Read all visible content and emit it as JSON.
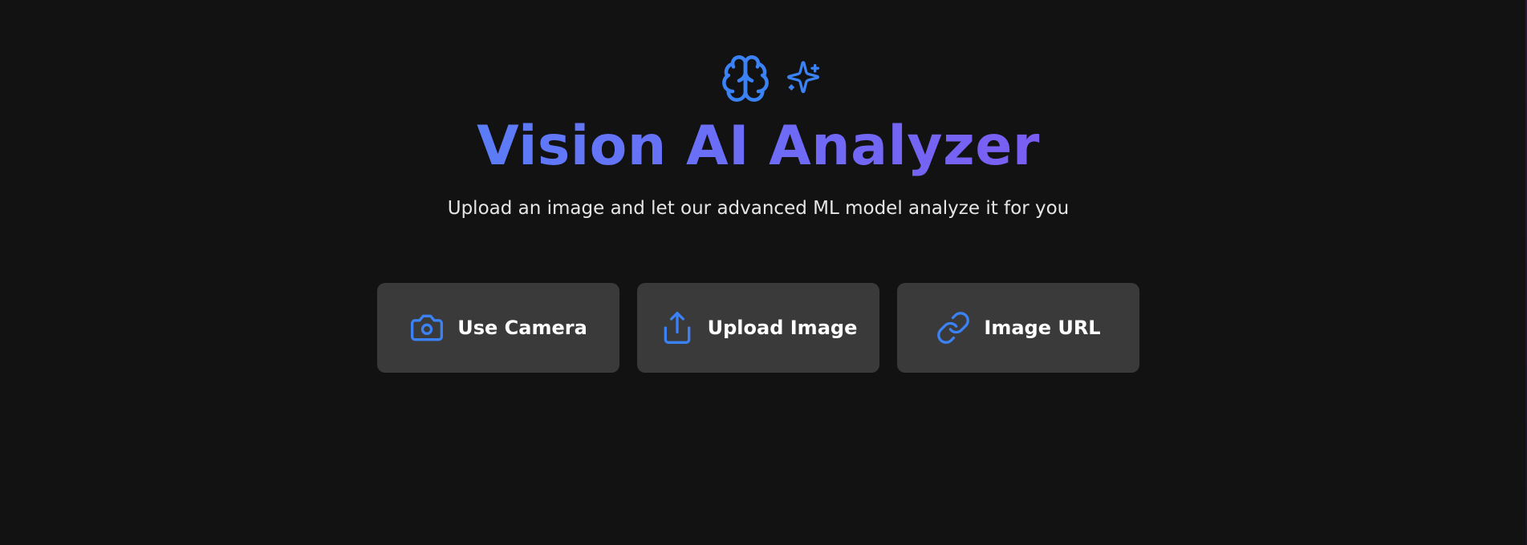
{
  "theme": {
    "background": "#121212",
    "accent": "#3b82f6",
    "title_gradient": [
      "#5b7cf7",
      "#7a5ef2"
    ],
    "button_background": "#3a3a3a"
  },
  "hero": {
    "icons": [
      "brain-icon",
      "sparkles-icon"
    ],
    "title": "Vision AI Analyzer",
    "subtitle": "Upload an image and let our advanced ML model analyze it for you"
  },
  "actions": [
    {
      "icon": "camera-icon",
      "label": "Use Camera"
    },
    {
      "icon": "upload-icon",
      "label": "Upload Image"
    },
    {
      "icon": "link-icon",
      "label": "Image URL"
    }
  ]
}
